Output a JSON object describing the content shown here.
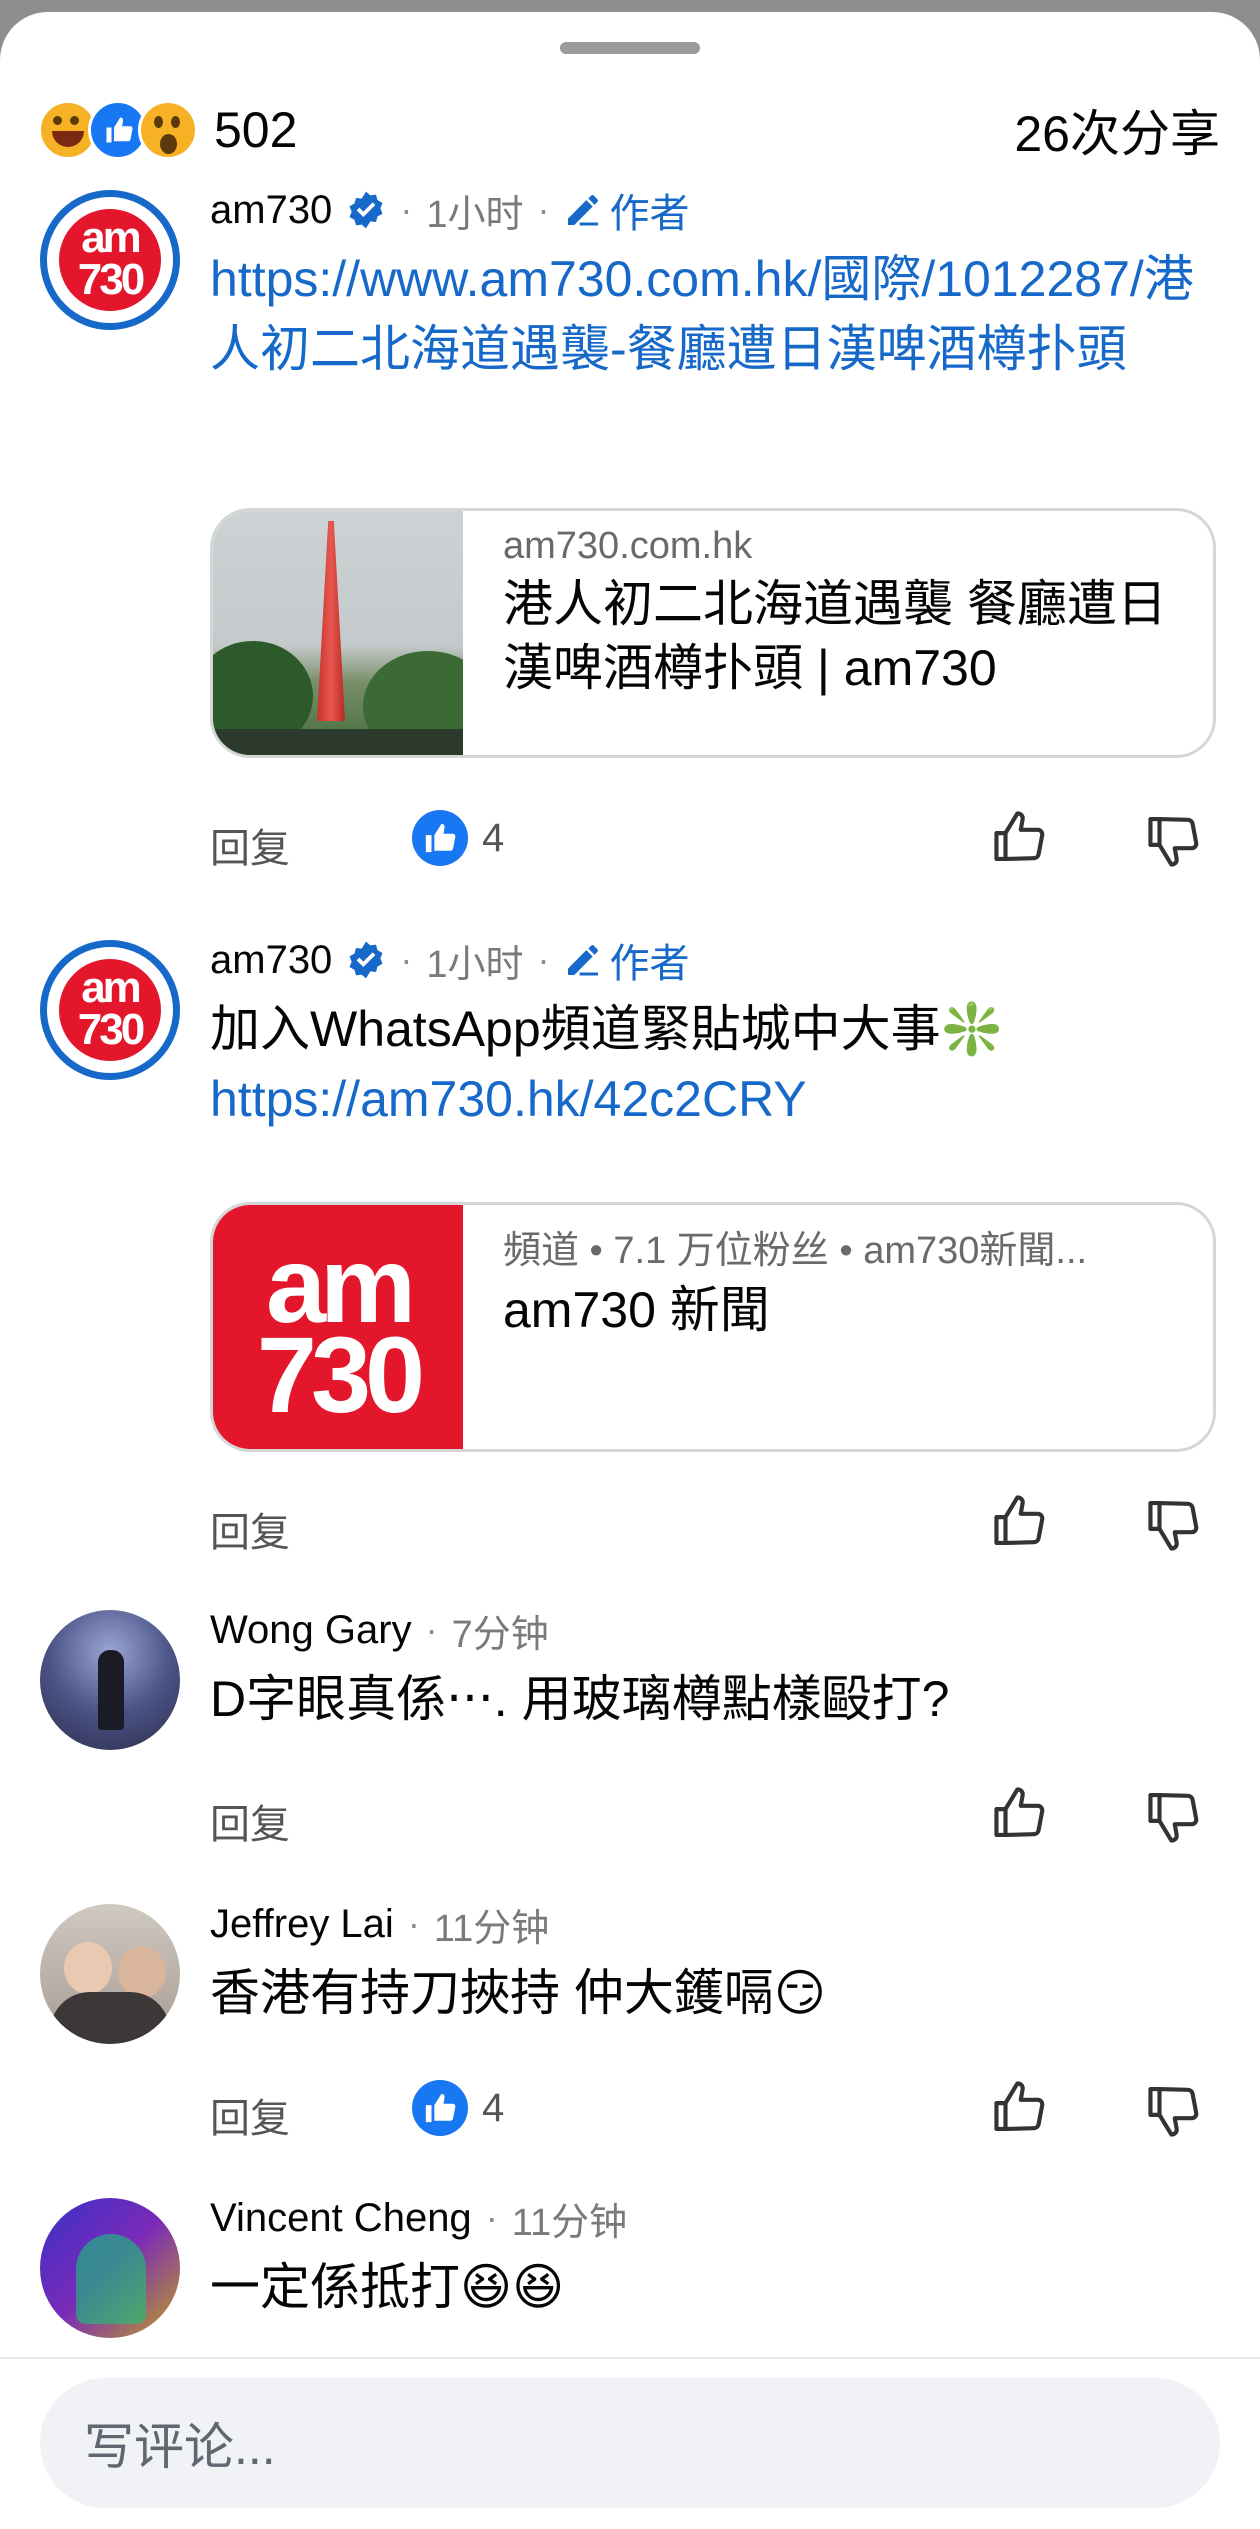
{
  "header": {
    "reactions": [
      "haha-icon",
      "like-icon",
      "wow-icon"
    ],
    "reaction_count": "502",
    "shares": "26次分享"
  },
  "comments": [
    {
      "name": "am730",
      "time": "1小时",
      "author_label": "作者",
      "text": "",
      "link": "https://www.am730.com.hk/國際/1012287/港人初二北海道遇襲-餐廳遭日漢啤酒樽扑頭",
      "card": {
        "domain": "am730.com.hk",
        "title": "港人初二北海道遇襲 餐廳遭日漢啤酒樽扑頭 | am730"
      },
      "reply_label": "回复",
      "likes": "4"
    },
    {
      "name": "am730",
      "time": "1小时",
      "author_label": "作者",
      "text": "加入WhatsApp頻道緊貼城中大事❇️",
      "link": "https://am730.hk/42c2CRY",
      "card": {
        "domain": "頻道 • 7.1 万位粉丝 • am730新聞...",
        "title": "am730 新聞",
        "logo_top": "am",
        "logo_bottom": "730"
      },
      "reply_label": "回复"
    },
    {
      "name": "Wong Gary",
      "time": "7分钟",
      "text": "D字眼真係‧‧‧. 用玻璃樽點樣毆打?",
      "reply_label": "回复"
    },
    {
      "name": "Jeffrey Lai",
      "time": "11分钟",
      "text": "香港有持刀挾持 仲大鑊嗝😏",
      "reply_label": "回复",
      "likes": "4"
    },
    {
      "name": "Vincent Cheng",
      "time": "11分钟",
      "text": "一定係抵打😆😆"
    }
  ],
  "avatar_logo": {
    "top": "am",
    "bottom": "730"
  },
  "composer": {
    "placeholder": "写评论..."
  },
  "colors": {
    "link": "#1769c9",
    "like_blue": "#1877f2",
    "brand_red": "#e3162c"
  }
}
